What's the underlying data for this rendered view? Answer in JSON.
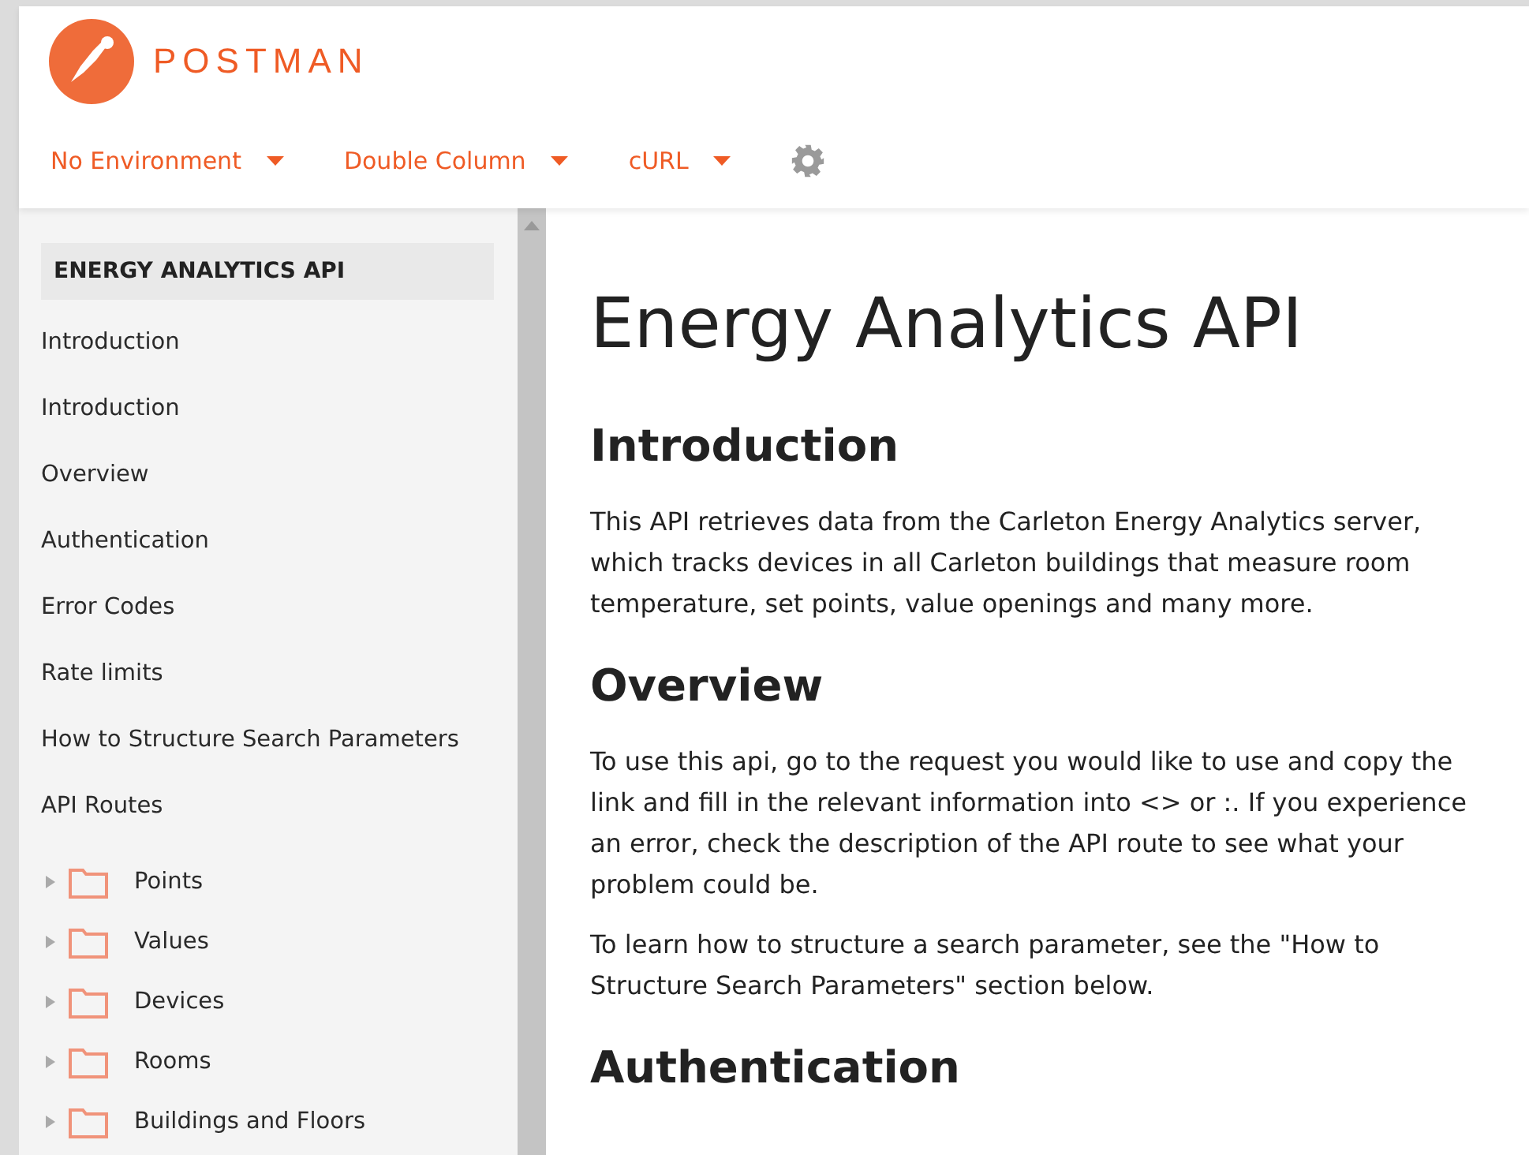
{
  "brand": {
    "name": "POSTMAN"
  },
  "toolbar": {
    "dropdowns": [
      {
        "label": "No Environment"
      },
      {
        "label": "Double Column"
      },
      {
        "label": "cURL"
      }
    ]
  },
  "sidebar": {
    "title": "ENERGY ANALYTICS API",
    "items": [
      {
        "label": "Introduction"
      },
      {
        "label": "Introduction"
      },
      {
        "label": "Overview"
      },
      {
        "label": "Authentication"
      },
      {
        "label": "Error Codes"
      },
      {
        "label": "Rate limits"
      },
      {
        "label": "How to Structure Search Parameters"
      },
      {
        "label": "API Routes"
      }
    ],
    "folders": [
      {
        "label": "Points",
        "expanded": false
      },
      {
        "label": "Values",
        "expanded": false
      },
      {
        "label": "Devices",
        "expanded": false
      },
      {
        "label": "Rooms",
        "expanded": false
      },
      {
        "label": "Buildings and Floors",
        "expanded": false
      }
    ]
  },
  "content": {
    "title": "Energy Analytics API",
    "sections": [
      {
        "heading": "Introduction",
        "paragraphs": [
          "This API retrieves data from the Carleton Energy Analytics server, which tracks devices in all Carleton buildings that measure room temperature, set points, value openings and many more."
        ]
      },
      {
        "heading": "Overview",
        "paragraphs": [
          "To use this api, go to the request you would like to use and copy the link and fill in the relevant information into <> or :. If you experience an error, check the description of the API route to see what your problem could be.",
          "To learn how to structure a search parameter, see the \"How to Structure Search Parameters\" section below."
        ]
      },
      {
        "heading": "Authentication"
      }
    ]
  }
}
